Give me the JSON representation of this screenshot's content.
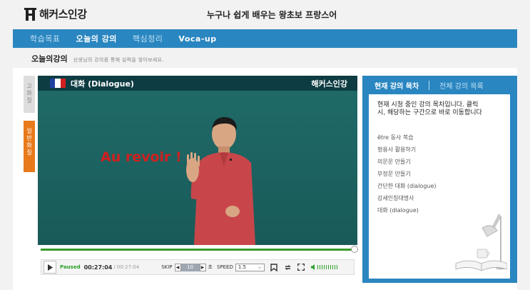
{
  "header": {
    "logo_text": "해커스인강",
    "course_title": "누구나 쉽게 배우는 왕초보 프랑스어"
  },
  "nav": {
    "items": [
      {
        "label": "학습목표",
        "active": false
      },
      {
        "label": "오늘의 강의",
        "active": true
      },
      {
        "label": "핵심정리",
        "active": false
      },
      {
        "label": "Voca-up",
        "active": false
      }
    ]
  },
  "subhead": {
    "title": "오늘의강의",
    "desc": "선생님의 강의를 통해 실력을 쌓아보세요."
  },
  "side_tabs": [
    {
      "label": "고화질"
    },
    {
      "label": "일반화질"
    }
  ],
  "video": {
    "label": "대화 (Dialogue)",
    "logo_text": "해커스인강",
    "caption": "Au revoir !",
    "flag_colors": [
      "#1f3fa0",
      "#ffffff",
      "#d21f1f"
    ]
  },
  "player": {
    "progress": 0.99,
    "status": "Paused",
    "time_current": "00:27:04",
    "time_sep": "/",
    "time_total": "00:27:04",
    "skip_label": "SKIP",
    "skip_value": "10",
    "skip_unit": "초",
    "speed_label": "SPEED",
    "speed_value": "1.5"
  },
  "toc": {
    "tab_current": "현재 강의 목차",
    "tab_all": "전체 강의 목록",
    "intro": "현재 시청 중인 강의 목차입니다. 클릭 시, 해당하는 구간으로 바로 이동합니다",
    "items": [
      "être 동사 복습",
      "형용사 활용하기",
      "의문문 만들기",
      "부정문 만들기",
      "간단한 대화 (dialogue)",
      "강세인칭대명사",
      "대화 (dialogue)"
    ]
  },
  "colors": {
    "nav_blue": "#2a86c0",
    "accent_orange": "#e87a1c",
    "progress_green": "#3a9a2a"
  }
}
